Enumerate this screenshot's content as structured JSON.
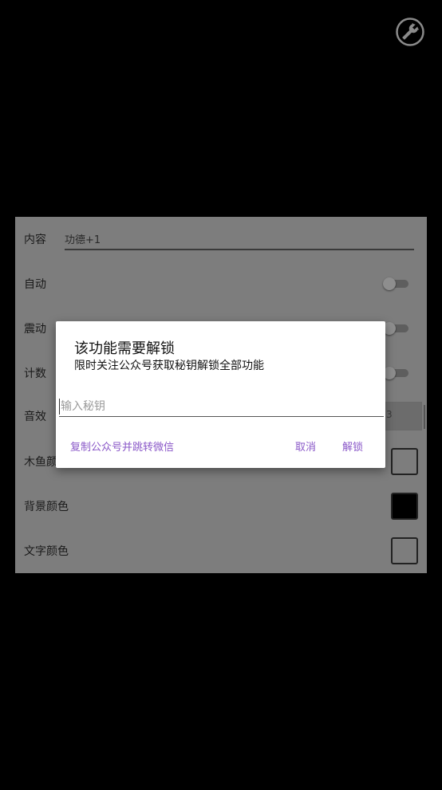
{
  "settings": {
    "content": {
      "label": "内容",
      "value": "功德+1"
    },
    "auto": {
      "label": "自动"
    },
    "vibrate": {
      "label": "震动"
    },
    "count": {
      "label": "计数"
    },
    "sound": {
      "label": "音效",
      "value_partial": "3"
    },
    "muyu_color": {
      "label": "木鱼颜色"
    },
    "bg_color": {
      "label": "背景颜色",
      "color": "#000000"
    },
    "text_color": {
      "label": "文字颜色",
      "color": "#ffffff"
    }
  },
  "dialog": {
    "title": "该功能需要解锁",
    "message": "限时关注公众号获取秘钥解锁全部功能",
    "input_placeholder": "输入秘钥",
    "copy_button": "复制公众号并跳转微信",
    "cancel_button": "取消",
    "unlock_button": "解锁"
  },
  "colors": {
    "accent": "#8a58c8"
  },
  "icons": {
    "tools": "wrench-icon"
  }
}
